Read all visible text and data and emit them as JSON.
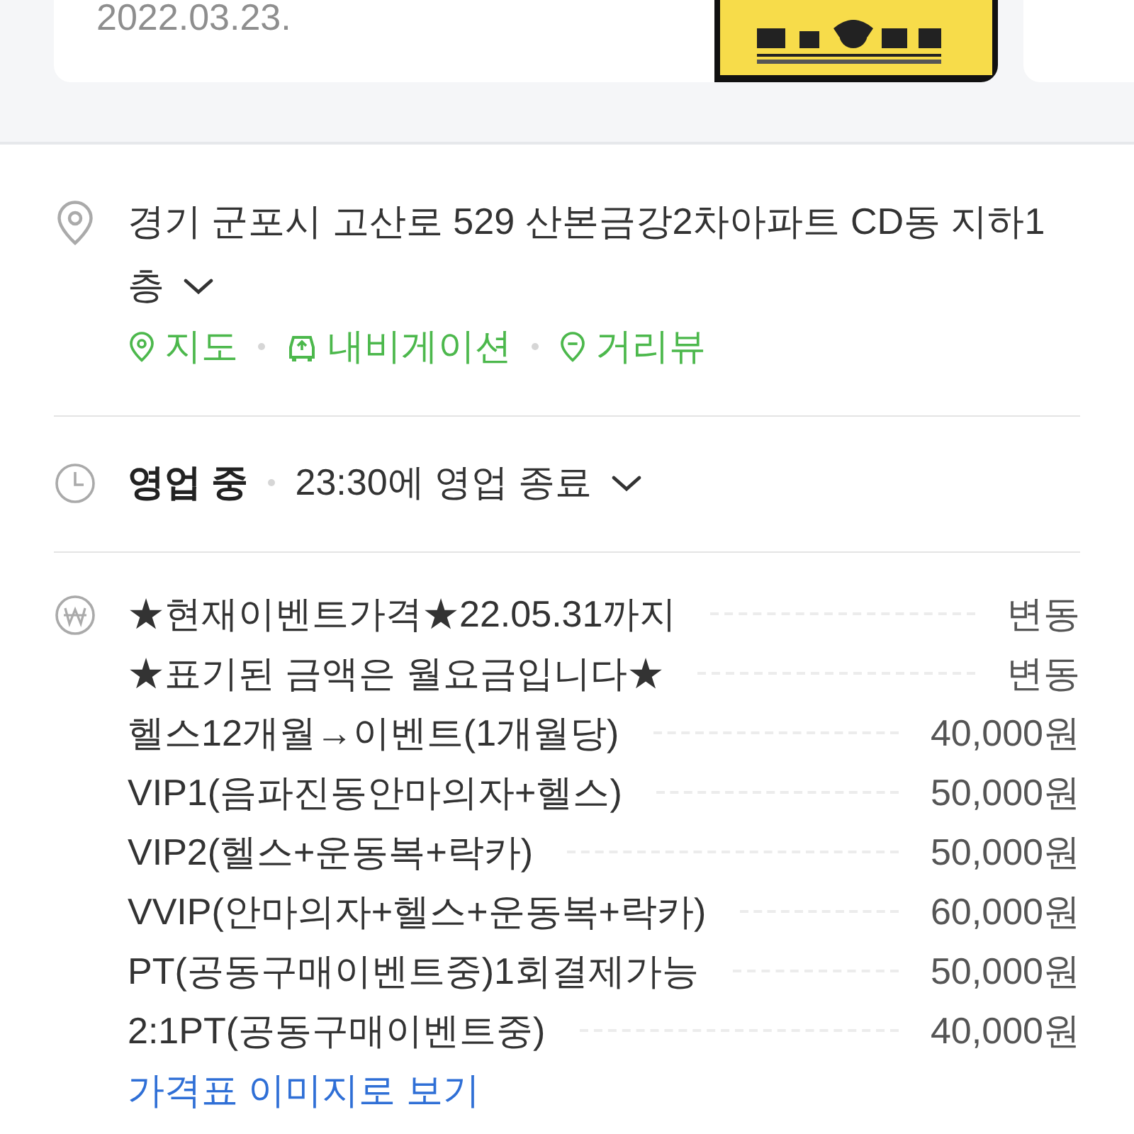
{
  "review_card": {
    "date": "2022.03.23."
  },
  "address": {
    "lines": [
      "경기 군포시 고산로 529 산본금강2차아파트 CD동 지하1",
      "층"
    ],
    "expanded": false,
    "links": [
      {
        "kind": "map",
        "label": "지도"
      },
      {
        "kind": "navigation",
        "label": "내비게이션"
      },
      {
        "kind": "streetview",
        "label": "거리뷰"
      }
    ]
  },
  "hours": {
    "status": "영업 중",
    "detail": "23:30에 영업 종료",
    "expanded": false
  },
  "prices": [
    {
      "name": "★현재이벤트가격★22.05.31까지",
      "price": "변동"
    },
    {
      "name": "★표기된 금액은 월요금입니다★",
      "price": "변동"
    },
    {
      "name": "헬스12개월→이벤트(1개월당)",
      "price": "40,000원"
    },
    {
      "name": "VIP1(음파진동안마의자+헬스)",
      "price": "50,000원"
    },
    {
      "name": "VIP2(헬스+운동복+락카)",
      "price": "50,000원"
    },
    {
      "name": "VVIP(안마의자+헬스+운동복+락카)",
      "price": "60,000원"
    },
    {
      "name": "PT(공동구매이벤트중)1회결제가능",
      "price": "50,000원"
    },
    {
      "name": "2:1PT(공동구매이벤트중)",
      "price": "40,000원"
    }
  ],
  "price_image_link": "가격표 이미지로 보기"
}
